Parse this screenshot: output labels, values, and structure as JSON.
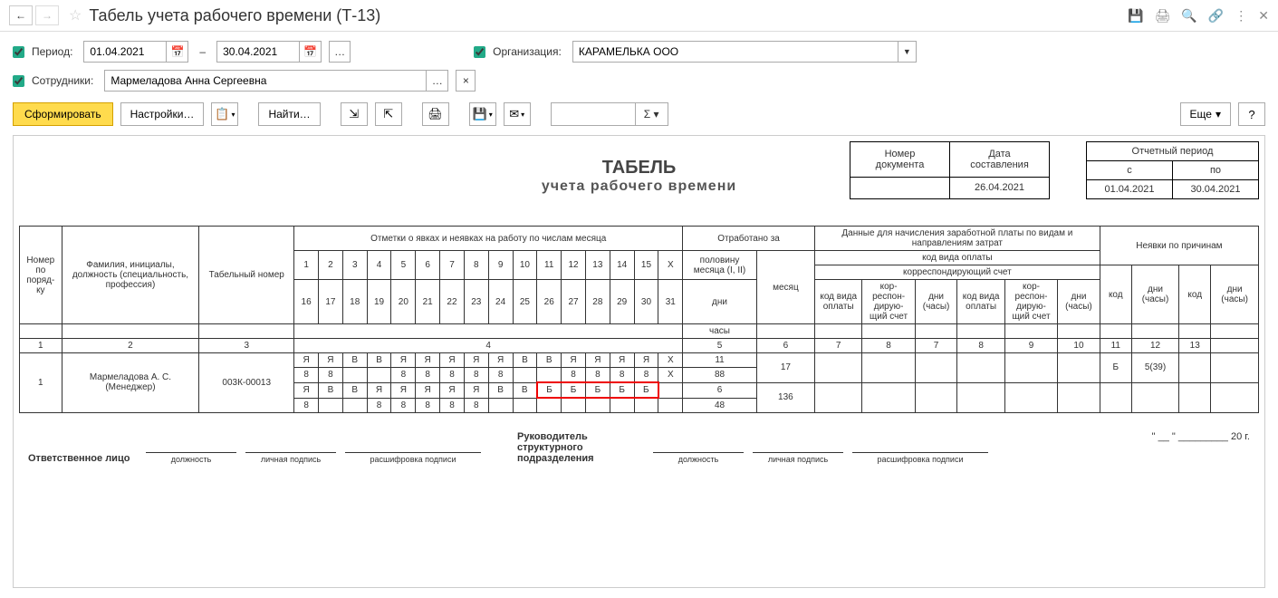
{
  "title": "Табель учета рабочего времени (Т-13)",
  "filters": {
    "period_label": "Период:",
    "date_from": "01.04.2021",
    "date_to": "30.04.2021",
    "dash": "–",
    "org_label": "Организация:",
    "org_value": "КАРАМЕЛЬКА ООО",
    "emp_label": "Сотрудники:",
    "emp_value": "Мармеладова Анна Сергеевна"
  },
  "toolbar": {
    "form": "Сформировать",
    "settings": "Настройки…",
    "find": "Найти…",
    "more": "Еще"
  },
  "report": {
    "title_line1": "ТАБЕЛЬ",
    "title_line2": "учета  рабочего времени",
    "doc_num_hdr": "Номер документа",
    "doc_date_hdr": "Дата составления",
    "doc_date": "26.04.2021",
    "period_hdr": "Отчетный период",
    "period_from_hdr": "с",
    "period_to_hdr": "по",
    "period_from": "01.04.2021",
    "period_to": "30.04.2021",
    "columns": {
      "num": "Номер по поряд- ку",
      "fio": "Фамилия, инициалы, должность (специальность, профессия)",
      "tabnum": "Табельный номер",
      "marks": "Отметки о явках и неявках на работу по числам месяца",
      "worked": "Отработано за",
      "half": "половину месяца (I, II)",
      "month": "месяц",
      "days": "дни",
      "hours": "часы",
      "payroll": "Данные для начисления заработной платы по видам и направлениям затрат",
      "paycode": "код вида оплаты",
      "corresp": "корреспондирующий счет",
      "paycode_s": "код вида оплаты",
      "corresp_s": "кор- респон- дирую- щий счет",
      "dh": "дни (часы)",
      "absence": "Неявки по причинам",
      "code": "код"
    },
    "colnums": [
      "1",
      "2",
      "3",
      "4",
      "5",
      "6",
      "7",
      "8",
      "7",
      "8",
      "9",
      "10",
      "11",
      "12",
      "13"
    ],
    "days1": [
      "1",
      "2",
      "3",
      "4",
      "5",
      "6",
      "7",
      "8",
      "9",
      "10",
      "11",
      "12",
      "13",
      "14",
      "15",
      "X"
    ],
    "days2": [
      "16",
      "17",
      "18",
      "19",
      "20",
      "21",
      "22",
      "23",
      "24",
      "25",
      "26",
      "27",
      "28",
      "29",
      "30",
      "31"
    ],
    "row": {
      "num": "1",
      "fio": "Мармеладова А. С. (Менеджер)",
      "tabnum": "003К-00013",
      "line1": [
        "Я",
        "Я",
        "В",
        "В",
        "Я",
        "Я",
        "Я",
        "Я",
        "Я",
        "В",
        "В",
        "Я",
        "Я",
        "Я",
        "Я",
        "X"
      ],
      "line2": [
        "8",
        "8",
        "",
        "",
        "8",
        "8",
        "8",
        "8",
        "8",
        "",
        "",
        "8",
        "8",
        "8",
        "8",
        "X"
      ],
      "line3": [
        "Я",
        "В",
        "В",
        "Я",
        "Я",
        "Я",
        "Я",
        "Я",
        "В",
        "В",
        "Б",
        "Б",
        "Б",
        "Б",
        "Б",
        ""
      ],
      "line4": [
        "8",
        "",
        "",
        "8",
        "8",
        "8",
        "8",
        "8",
        "",
        "",
        "",
        "",
        "",
        "",
        "",
        ""
      ],
      "half1_days": "11",
      "half1_hours": "88",
      "half2_days": "6",
      "half2_hours": "48",
      "month_days": "17",
      "month_hours": "136",
      "abs_code": "Б",
      "abs_dh": "5(39)"
    }
  },
  "signatures": {
    "resp": "Ответственное лицо",
    "position": "должность",
    "sign": "личная подпись",
    "decode": "расшифровка подписи",
    "head": "Руководитель структурного подразделения",
    "date_tpl": "\" __ \" _________ 20   г."
  }
}
